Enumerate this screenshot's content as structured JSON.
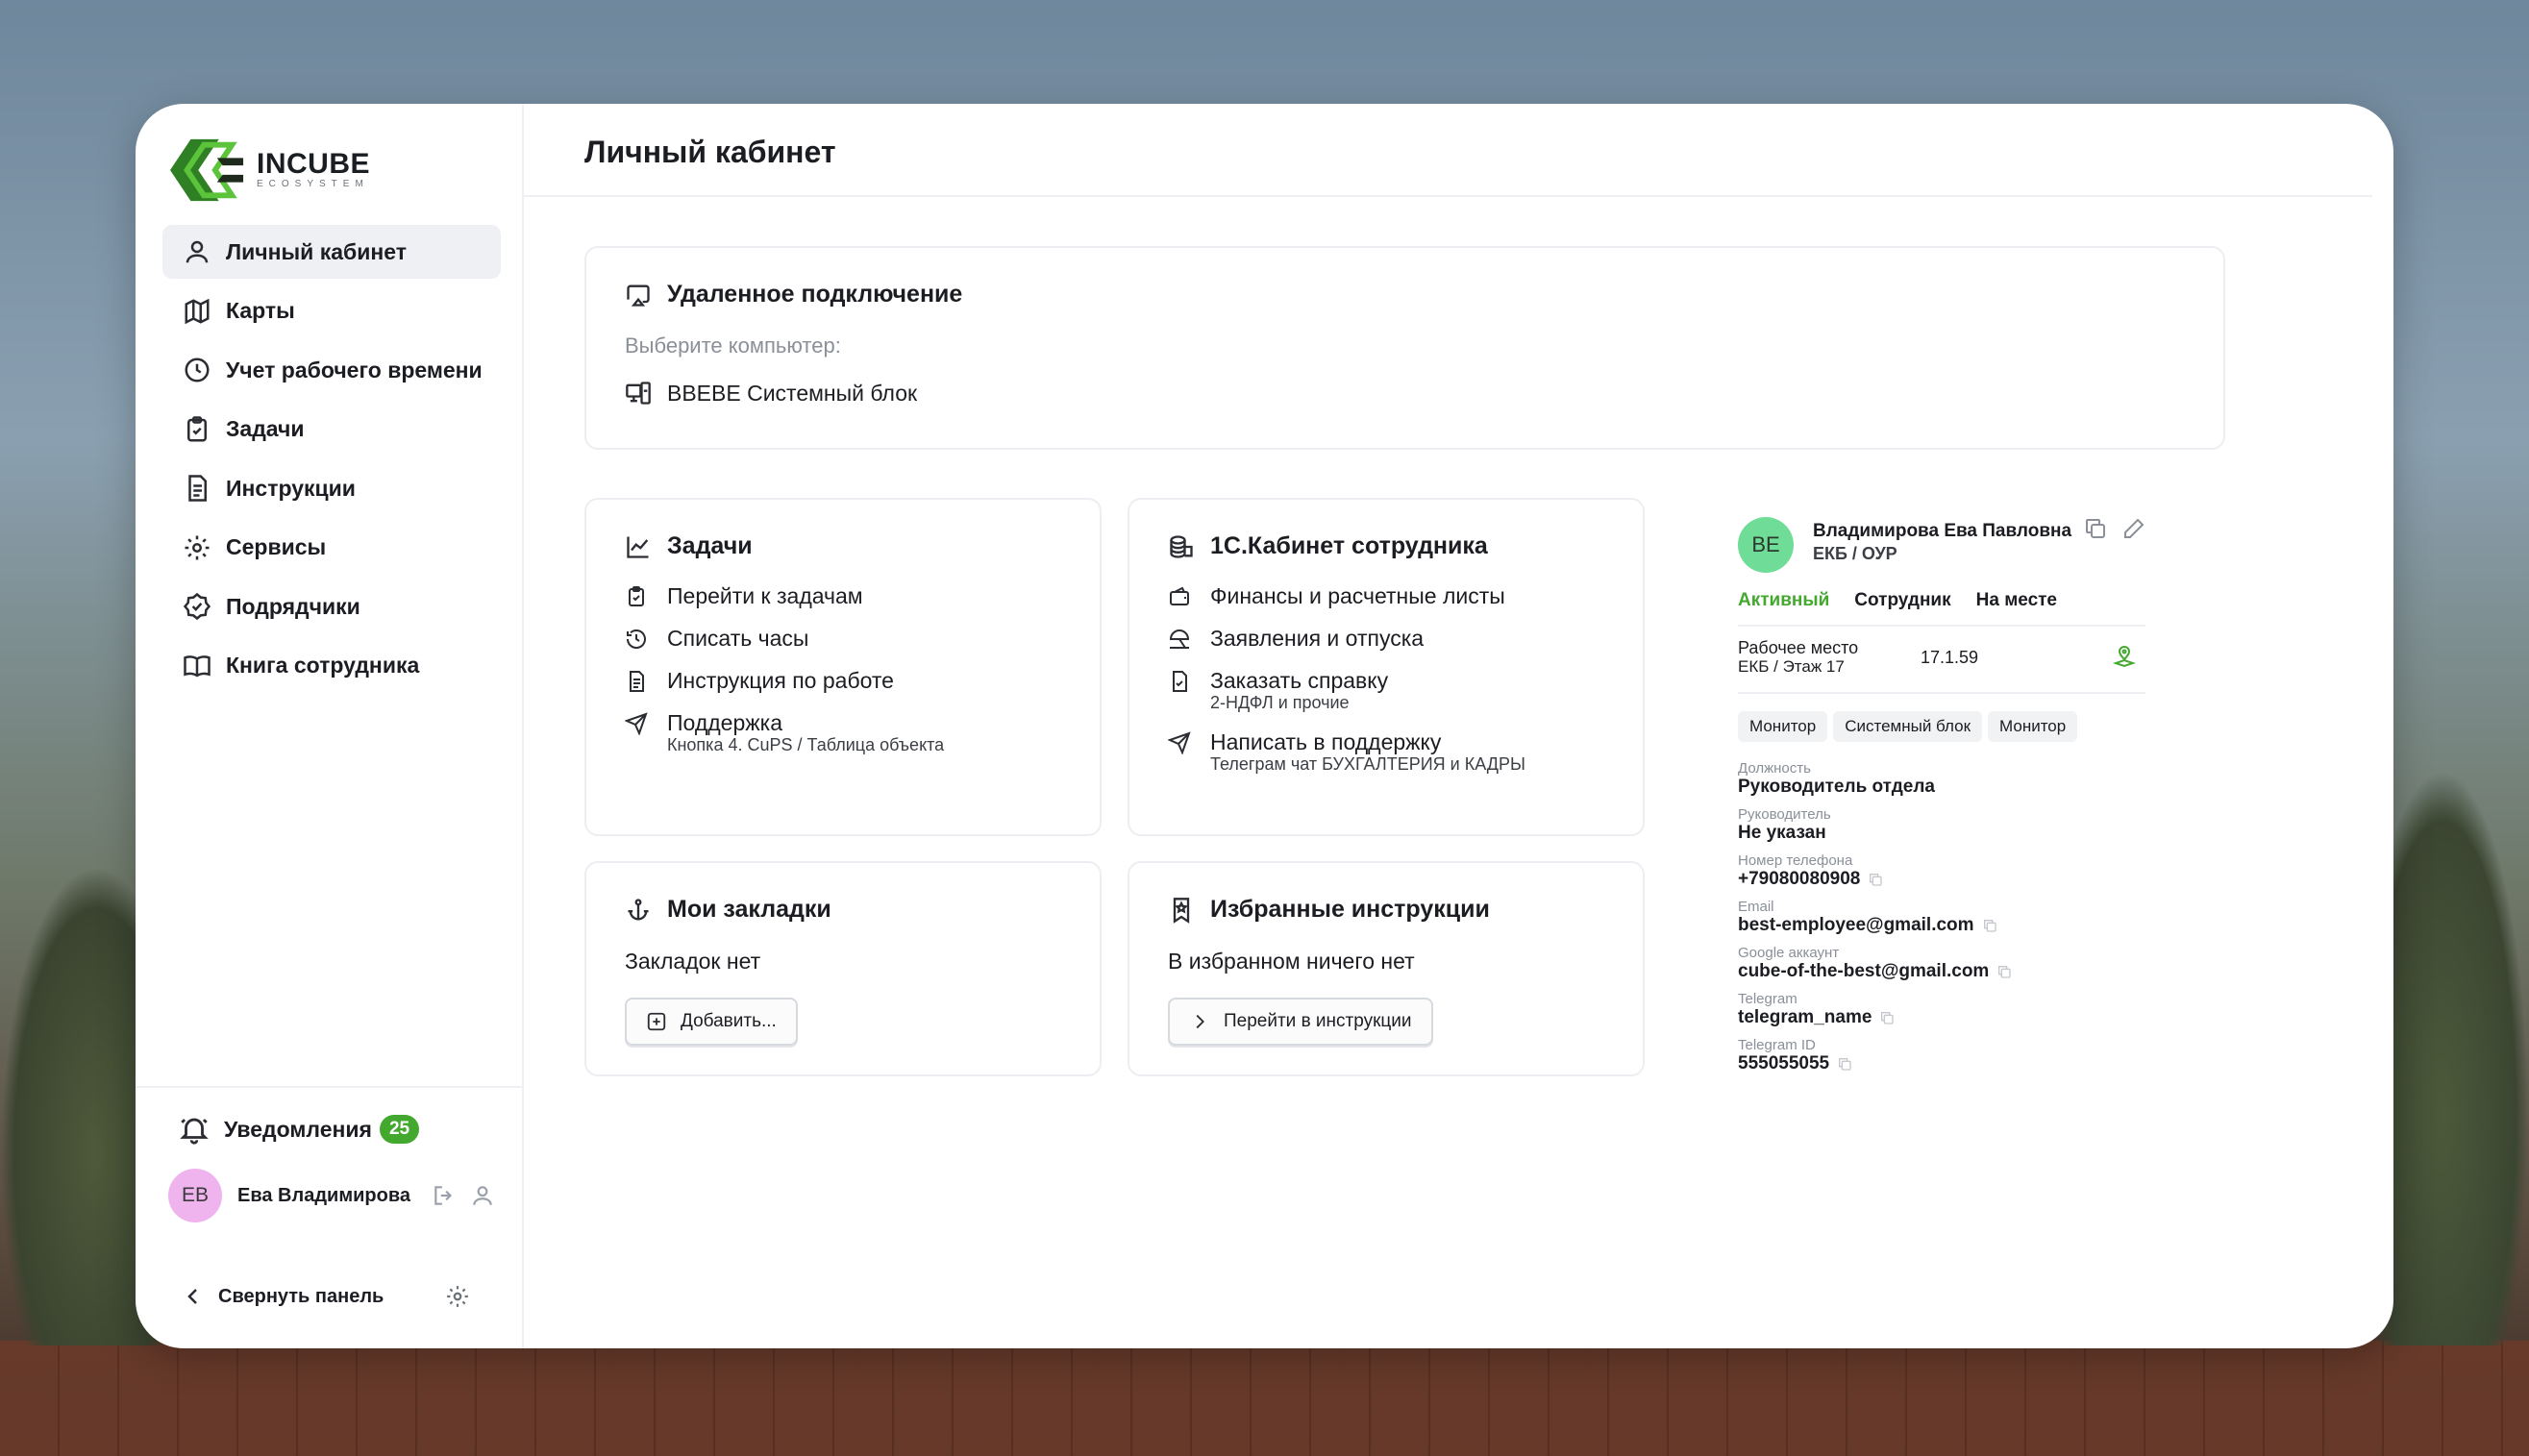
{
  "brand": {
    "title": "INCUBE",
    "subtitle": "ECOSYSTEM",
    "color": "#3c9a2c"
  },
  "sidebar": {
    "items": [
      {
        "label": "Личный кабинет",
        "icon": "user-icon",
        "active": true
      },
      {
        "label": "Карты",
        "icon": "map-icon"
      },
      {
        "label": "Учет рабочего времени",
        "icon": "clock-icon"
      },
      {
        "label": "Задачи",
        "icon": "clipboard-check-icon"
      },
      {
        "label": "Инструкции",
        "icon": "document-icon"
      },
      {
        "label": "Сервисы",
        "icon": "gear-icon"
      },
      {
        "label": "Подрядчики",
        "icon": "badge-check-icon"
      },
      {
        "label": "Книга сотрудника",
        "icon": "book-icon"
      }
    ],
    "notifications": {
      "label": "Уведомления",
      "count": "25"
    },
    "user": {
      "initials": "ЕВ",
      "name": "Ева Владимирова"
    },
    "collapse_label": "Свернуть панель"
  },
  "page": {
    "title": "Личный кабинет"
  },
  "remote": {
    "title": "Удаленное подключение",
    "prompt": "Выберите компьютер:",
    "computer": "BBEBE Системный блок"
  },
  "tasks": {
    "title": "Задачи",
    "items": [
      {
        "label": "Перейти к задачам",
        "sub": ""
      },
      {
        "label": "Списать часы",
        "sub": ""
      },
      {
        "label": "Инструкция по работе",
        "sub": ""
      },
      {
        "label": "Поддержка",
        "sub": "Кнопка 4. CuPS / Таблица объекта"
      }
    ]
  },
  "onec": {
    "title": "1С.Кабинет сотрудника",
    "items": [
      {
        "label": "Финансы и расчетные листы",
        "sub": ""
      },
      {
        "label": "Заявления и отпуска",
        "sub": ""
      },
      {
        "label": "Заказать справку",
        "sub": "2-НДФЛ и прочие"
      },
      {
        "label": "Написать в поддержку",
        "sub": "Телеграм чат БУХГАЛТЕРИЯ и КАДРЫ"
      }
    ]
  },
  "bookmarks": {
    "title": "Мои закладки",
    "empty": "Закладок нет",
    "button": "Добавить..."
  },
  "favorites": {
    "title": "Избранные инструкции",
    "empty": "В избранном ничего нет",
    "button": "Перейти в инструкции"
  },
  "profile": {
    "initials": "ВЕ",
    "name": "Владимирова Ева Павловна",
    "dept": "ЕКБ / ОУР",
    "status": [
      "Активный",
      "Сотрудник",
      "На месте"
    ],
    "workplace": {
      "label": "Рабочее место",
      "location": "ЕКБ / Этаж 17",
      "number": "17.1.59"
    },
    "devices": [
      "Монитор",
      "Системный блок",
      "Монитор"
    ],
    "fields": {
      "position": {
        "label": "Должность",
        "value": "Руководитель отдела"
      },
      "manager": {
        "label": "Руководитель",
        "value": "Не указан"
      },
      "phone": {
        "label": "Номер телефона",
        "value": "+79080080908"
      },
      "email": {
        "label": "Email",
        "value": "best-employee@gmail.com"
      },
      "google": {
        "label": "Google аккаунт",
        "value": "cube-of-the-best@gmail.com"
      },
      "telegram": {
        "label": "Telegram",
        "value": "telegram_name"
      },
      "telegram_id": {
        "label": "Telegram ID",
        "value": "555055055"
      }
    }
  },
  "colors": {
    "accent_green": "#43a82e",
    "avatar_user": "#efb3ee",
    "avatar_profile": "#6fdc97"
  }
}
